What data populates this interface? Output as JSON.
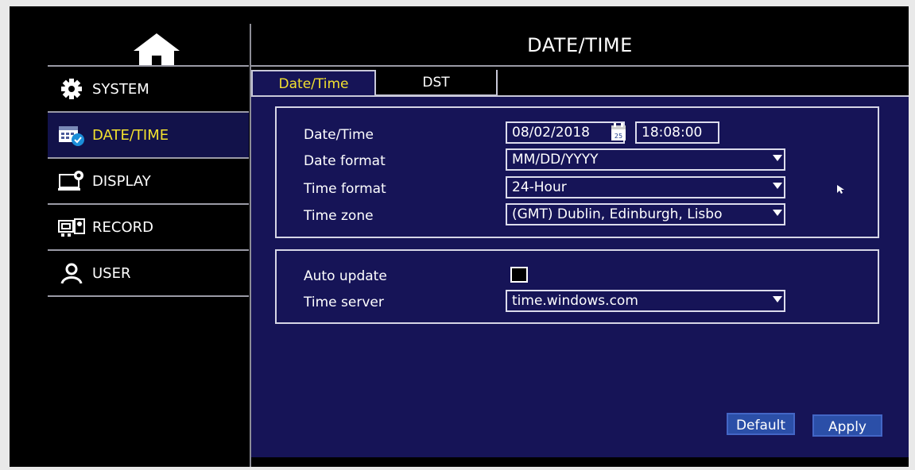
{
  "header": {
    "title": "DATE/TIME"
  },
  "sidebar": {
    "items": [
      {
        "label": "SYSTEM",
        "icon": "gear-icon",
        "active": false
      },
      {
        "label": "DATE/TIME",
        "icon": "calendar-check-icon",
        "active": true
      },
      {
        "label": "DISPLAY",
        "icon": "monitor-gear-icon",
        "active": false
      },
      {
        "label": "RECORD",
        "icon": "camera-icon",
        "active": false
      },
      {
        "label": "USER",
        "icon": "user-icon",
        "active": false
      }
    ]
  },
  "tabs": [
    {
      "label": "Date/Time",
      "active": true
    },
    {
      "label": "DST",
      "active": false
    }
  ],
  "datetime_group": {
    "date_time_label": "Date/Time",
    "date_value": "08/02/2018",
    "time_value": "18:08:00",
    "date_format_label": "Date format",
    "date_format_value": "MM/DD/YYYY",
    "time_format_label": "Time format",
    "time_format_value": "24-Hour",
    "time_zone_label": "Time zone",
    "time_zone_value": "(GMT) Dublin, Edinburgh, Lisbo"
  },
  "sync_group": {
    "auto_update_label": "Auto update",
    "auto_update_checked": false,
    "time_server_label": "Time server",
    "time_server_value": "time.windows.com"
  },
  "buttons": {
    "default_label": "Default",
    "apply_label": "Apply"
  },
  "colors": {
    "panel_bg": "#161457",
    "accent_yellow": "#f3e12f",
    "button_bg": "#2b4fa8",
    "screen_bg": "#000000"
  }
}
